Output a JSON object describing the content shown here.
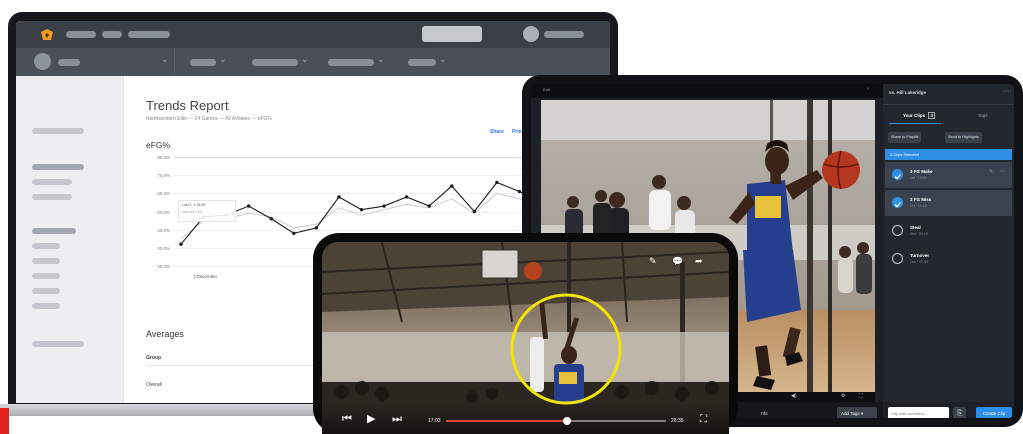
{
  "laptop": {
    "report_title": "Trends Report",
    "report_subtitle": "Northwestern Elite — 24 Games — All Athletes — eFG%",
    "actions": [
      "Share",
      "Print",
      "Ex"
    ],
    "metric_title": "eFG%",
    "y_ticks": [
      "80.0%",
      "70.0%",
      "60.0%",
      "50.0%",
      "40.0%",
      "30.0%",
      "20.0%"
    ],
    "x_label": "| December",
    "tooltip_line1": "Last 1: ± 16.05",
    "tooltip_line2": "Non-Art 0.01",
    "averages_title": "Averages",
    "table_header": "Group",
    "table_row": "Overall"
  },
  "chart_data": {
    "type": "line",
    "title": "eFG%",
    "ylim": [
      20,
      80
    ],
    "series": [
      {
        "values": [
          32,
          47,
          48,
          53,
          46,
          38,
          41,
          58,
          51,
          53,
          58,
          53,
          64,
          50,
          66,
          61,
          55
        ]
      },
      {
        "values": [
          35,
          45,
          46,
          49,
          47,
          41,
          43,
          52,
          48,
          51,
          54,
          52,
          57,
          49,
          60,
          57,
          53
        ]
      }
    ]
  },
  "tablet": {
    "top_label": "Edit",
    "panel_title": "vs. Hill Lakeridge",
    "tabs": [
      "Your Clips",
      "Tags"
    ],
    "clip_count": "3",
    "buttons": [
      "Share to Playlist",
      "Send to Highlights"
    ],
    "selected_label": "2 Clips Selected",
    "clips": [
      {
        "name": "3 FG Make",
        "sub": "1st · 12:08",
        "checked": true
      },
      {
        "name": "2 FG Miss",
        "sub": "1st · 10:42",
        "checked": true
      },
      {
        "name": "Steal",
        "sub": "2nd · 09:15",
        "checked": false
      },
      {
        "name": "Turnover",
        "sub": "2nd · 07:33",
        "checked": false
      }
    ],
    "add_tags": "Add Tags",
    "comment_placeholder": "Clip with comment...",
    "create_clip": "Create Clip",
    "bottom_label": "nts"
  },
  "phone": {
    "time_current": "17:03",
    "time_total": "26:35",
    "progress": 0.55
  },
  "colors": {
    "accent_blue": "#2d8fe6",
    "highlight_yellow": "#f2e600",
    "progress_red": "#e0473a",
    "brand_red": "#e2211c",
    "logo_orange": "#f29a1b"
  },
  "icons": [
    "logo-icon",
    "avatar-icon",
    "chevron-down-icon",
    "rewind-icon",
    "play-icon",
    "skip-forward-icon",
    "fullscreen-icon",
    "check-icon",
    "draw-icon",
    "comment-icon"
  ]
}
